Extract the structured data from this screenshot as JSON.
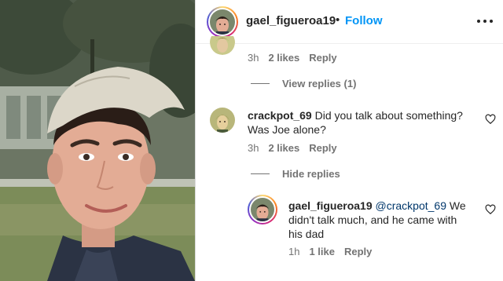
{
  "header": {
    "username": "gael_figueroa19",
    "separator": "•",
    "follow_label": "Follow"
  },
  "comments": [
    {
      "partial": true,
      "time": "3h",
      "likes": "2 likes",
      "reply_label": "Reply",
      "replies_toggle": "View replies (1)"
    },
    {
      "username": "crackpot_69",
      "text_line1": "Did you talk about something?",
      "text_line2": "Was Joe alone?",
      "time": "3h",
      "likes": "2 likes",
      "reply_label": "Reply",
      "replies_toggle": "Hide replies",
      "replies": [
        {
          "username": "gael_figueroa19",
          "mention": "@crackpot_69",
          "text_line1_rest": "We",
          "text_line2": "didn't talk much, and he came with",
          "text_line3": "his dad",
          "time": "1h",
          "likes": "1 like",
          "reply_label": "Reply"
        }
      ]
    }
  ]
}
